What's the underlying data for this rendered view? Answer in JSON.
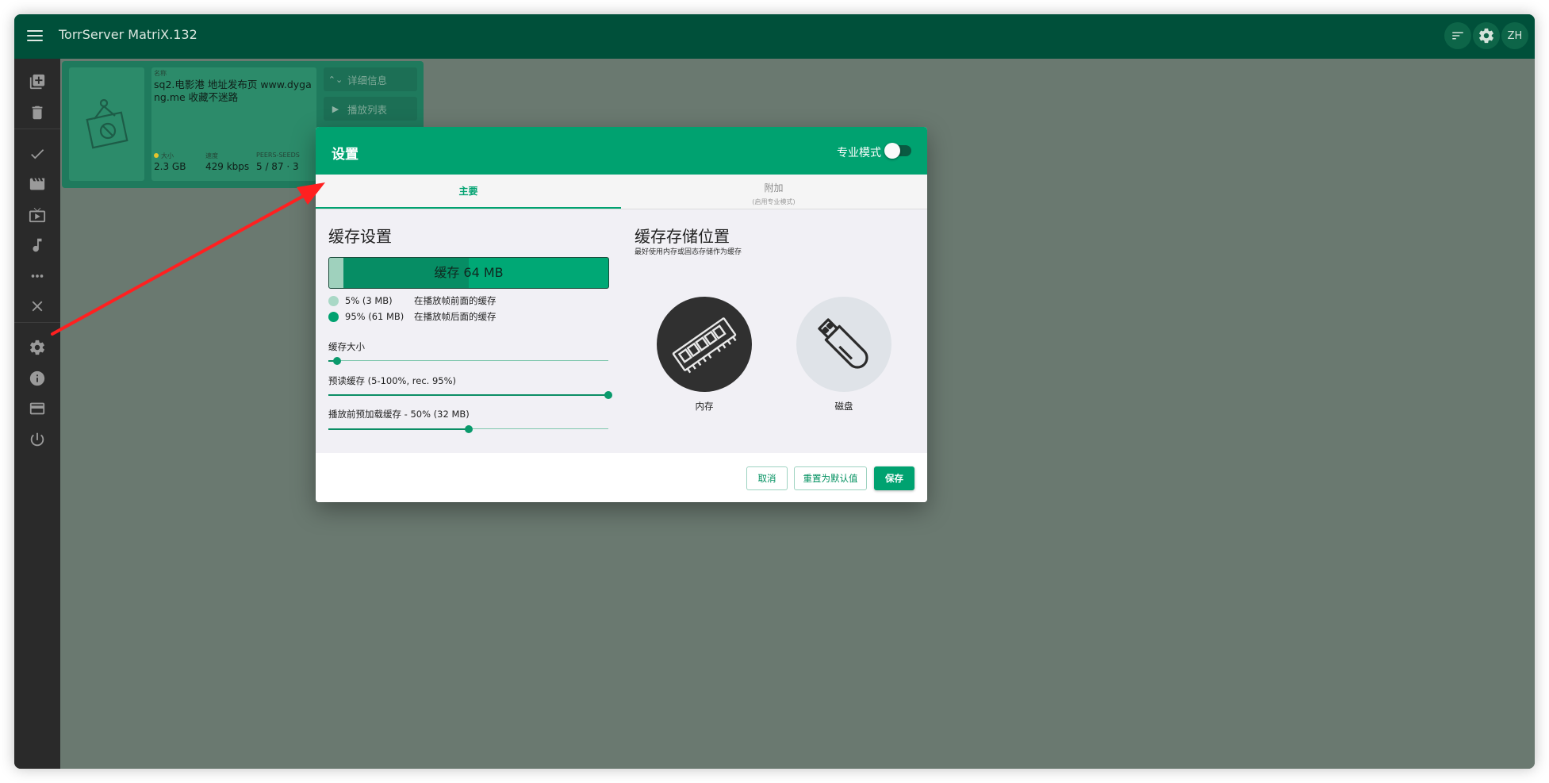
{
  "app": {
    "title": "TorrServer MatriX.132",
    "lang_badge": "ZH"
  },
  "colors": {
    "header": "#00503a",
    "accent": "#00a270",
    "sidebar": "#2a2a2a",
    "arrow": "#ff2020"
  },
  "sidebar": {
    "items": [
      {
        "icon": "add-torrent-icon"
      },
      {
        "icon": "delete-icon"
      },
      {
        "icon": "check-icon"
      },
      {
        "icon": "movie-icon"
      },
      {
        "icon": "tv-icon"
      },
      {
        "icon": "music-icon"
      },
      {
        "icon": "more-icon"
      },
      {
        "icon": "close-icon"
      },
      {
        "icon": "settings-icon"
      },
      {
        "icon": "info-icon"
      },
      {
        "icon": "card-icon"
      },
      {
        "icon": "power-icon"
      }
    ]
  },
  "torrent": {
    "name_label": "名称",
    "name": "sq2.电影港 地址发布页 www.dygang.me 收藏不迷路",
    "size_label": "大小",
    "size": "2.3 GB",
    "speed_label": "速度",
    "speed": "429 kbps",
    "peers_label": "PEERS-SEEDS",
    "peers": "5 / 87 · 3",
    "details_button": "详细信息",
    "playlist_button": "播放列表"
  },
  "dialog": {
    "title": "设置",
    "pro_mode_label": "专业模式",
    "pro_mode_on": false,
    "tabs": [
      {
        "label": "主要"
      },
      {
        "label": "附加",
        "sublabel": "(启用专业模式)"
      }
    ],
    "cache": {
      "title": "缓存设置",
      "bar_text": "缓存 64 MB",
      "legend": [
        {
          "value": "5% (3 MB)",
          "desc": "在播放帧前面的缓存",
          "color": "#a9d8c6"
        },
        {
          "value": "95% (61 MB)",
          "desc": "在播放帧后面的缓存",
          "color": "#00a270"
        }
      ],
      "sliders": [
        {
          "label": "缓存大小",
          "fraction": 0.03
        },
        {
          "label": "预读缓存 (5-100%, rec. 95%)",
          "fraction": 1.0
        },
        {
          "label": "播放前预加载缓存 - 50% (32 MB)",
          "fraction": 0.5
        }
      ]
    },
    "storage": {
      "title": "缓存存储位置",
      "subtitle": "最好使用内存或固态存储作为缓存",
      "options": [
        {
          "label": "内存",
          "icon": "memory-icon",
          "selected": true
        },
        {
          "label": "磁盘",
          "icon": "usb-drive-icon",
          "selected": false
        }
      ]
    },
    "buttons": {
      "cancel": "取消",
      "reset": "重置为默认值",
      "save": "保存"
    }
  }
}
